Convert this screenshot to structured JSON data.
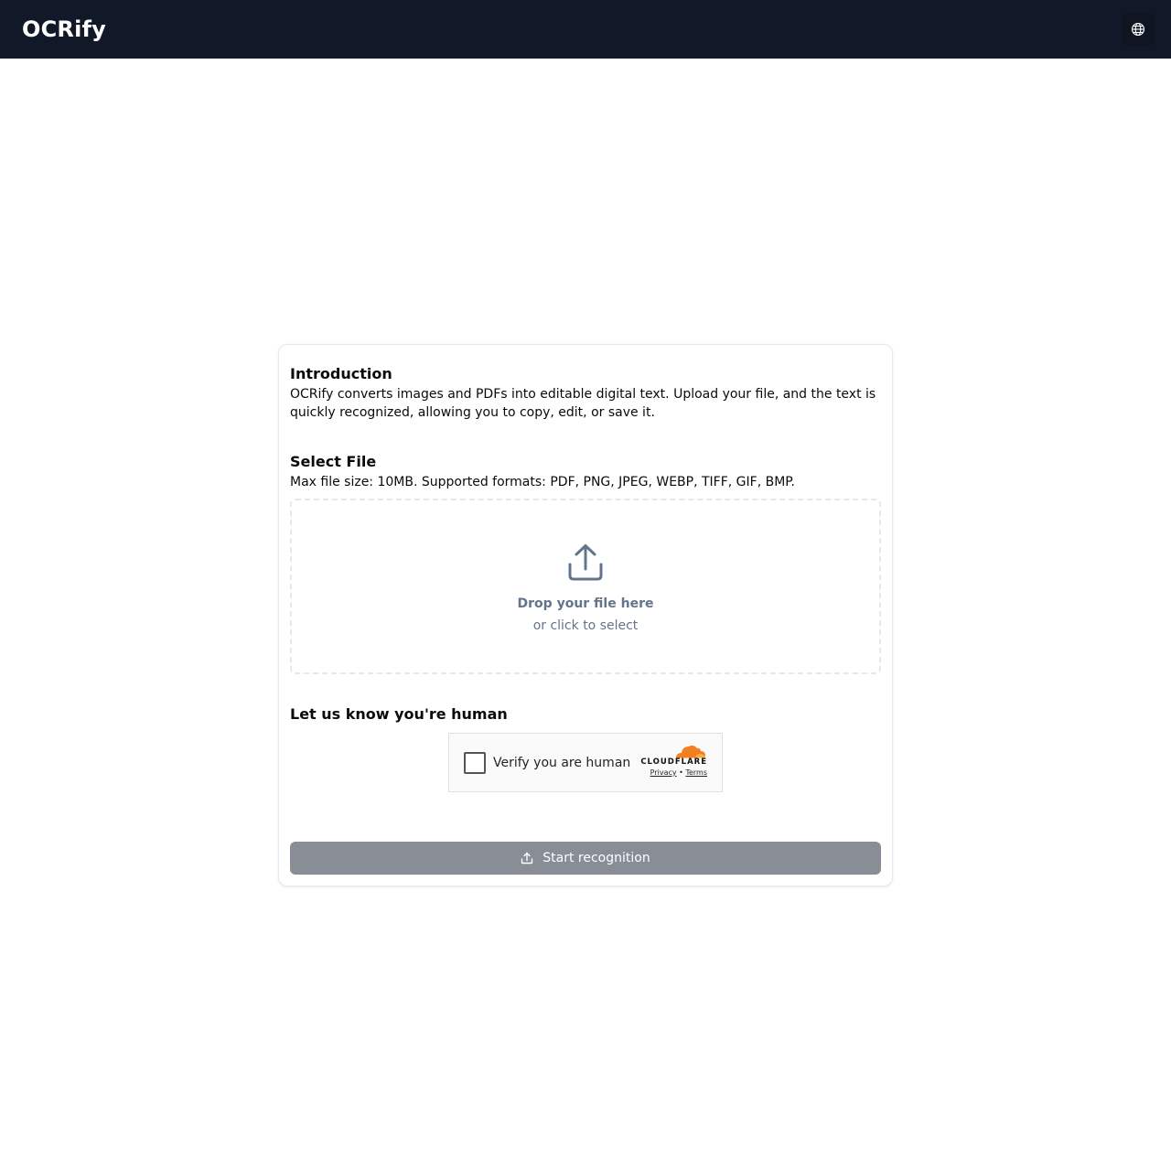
{
  "header": {
    "brand": "OCRify",
    "language_icon": "globe-icon"
  },
  "intro": {
    "heading": "Introduction",
    "text": "OCRify converts images and PDFs into editable digital text. Upload your file, and the text is quickly recognized, allowing you to copy, edit, or save it."
  },
  "select_file": {
    "heading": "Select File",
    "text": "Max file size: 10MB. Supported formats: PDF, PNG, JPEG, WEBP, TIFF, GIF, BMP.",
    "icon": "upload-icon",
    "drop_title": "Drop your file here",
    "drop_subtitle": "or click to select"
  },
  "human_check": {
    "heading": "Let us know you're human",
    "checkbox_label": "Verify you are human",
    "brand": "CLOUDFLARE",
    "privacy_link": "Privacy",
    "separator": "•",
    "terms_link": "Terms",
    "checked": false
  },
  "actions": {
    "start_label": "Start recognition",
    "start_icon": "upload-icon",
    "start_enabled": false
  },
  "colors": {
    "header_bg": "#111827",
    "button_disabled_bg": "#888d96",
    "muted_text": "#64748b",
    "cloudflare_orange": "#f38020"
  }
}
